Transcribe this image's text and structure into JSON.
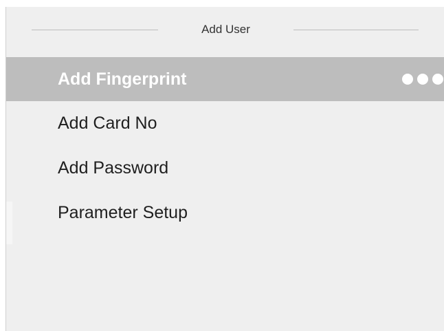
{
  "header": {
    "title": "Add User"
  },
  "menu": {
    "items": [
      {
        "label": "Add Fingerprint",
        "active": true
      },
      {
        "label": "Add Card No",
        "active": false
      },
      {
        "label": "Add Password",
        "active": false
      },
      {
        "label": "Parameter Setup",
        "active": false
      }
    ]
  },
  "indicator": {
    "icon": "three-dots-icon",
    "dot_count": 3
  },
  "colors": {
    "panel_background": "#efefef",
    "active_row_background": "#bdbdbd",
    "active_text": "#ffffff",
    "text": "#1f1f1f"
  }
}
